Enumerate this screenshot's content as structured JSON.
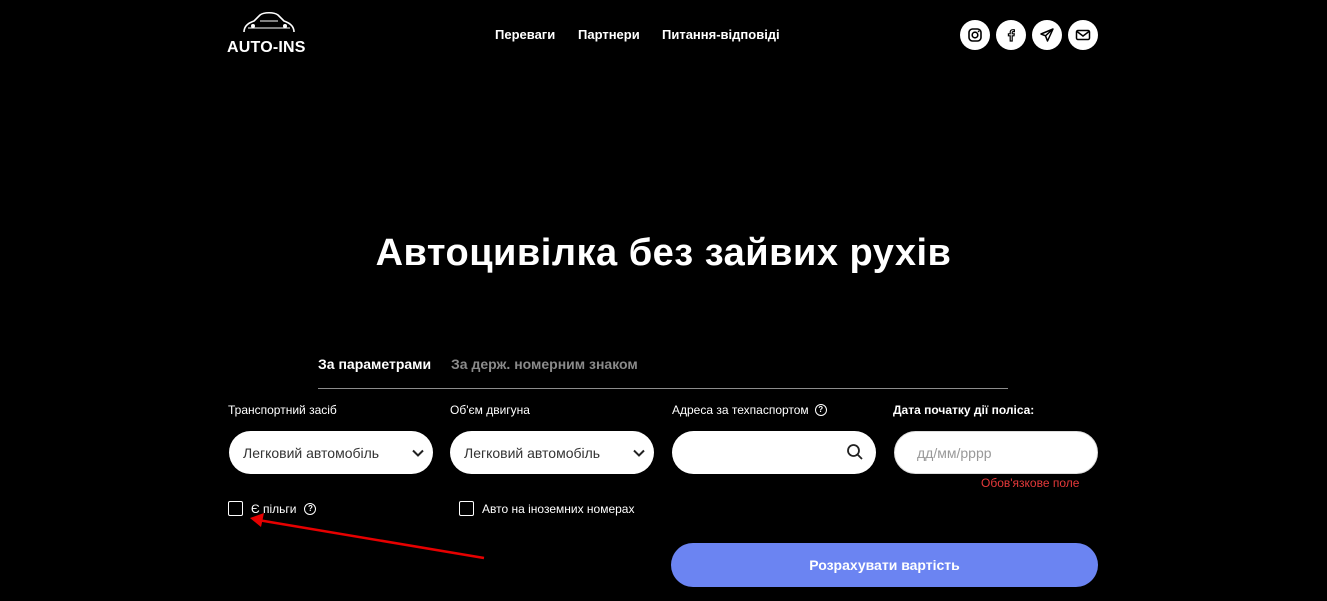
{
  "header": {
    "logo_text": "AUTO-INS",
    "nav": [
      "Переваги",
      "Партнери",
      "Питання-відповіді"
    ],
    "social_icons": [
      "instagram-icon",
      "facebook-icon",
      "telegram-icon",
      "mail-icon"
    ]
  },
  "hero": {
    "title": "Автоцивілка без зайвих рухів"
  },
  "tabs": {
    "active": "За параметрами",
    "inactive": "За держ. номерним знаком"
  },
  "form": {
    "vehicle_label": "Транспортний засіб",
    "vehicle_value": "Легковий автомобіль",
    "engine_label": "Об'єм двигуна",
    "engine_value": "Легковий автомобіль",
    "address_label": "Адреса за техпаспортом",
    "address_value": "",
    "date_label": "Дата початку дії поліса:",
    "date_placeholder": "дд/мм/рррр",
    "required_msg": "Обов'язкове поле",
    "benefits_label": "Є пільги",
    "foreign_label": "Авто на іноземних номерах",
    "submit_label": "Розрахувати вартість"
  },
  "colors": {
    "background": "#000000",
    "accent_button": "#6b84f2",
    "error": "#e5393a",
    "annotation_arrow": "#e60000"
  }
}
